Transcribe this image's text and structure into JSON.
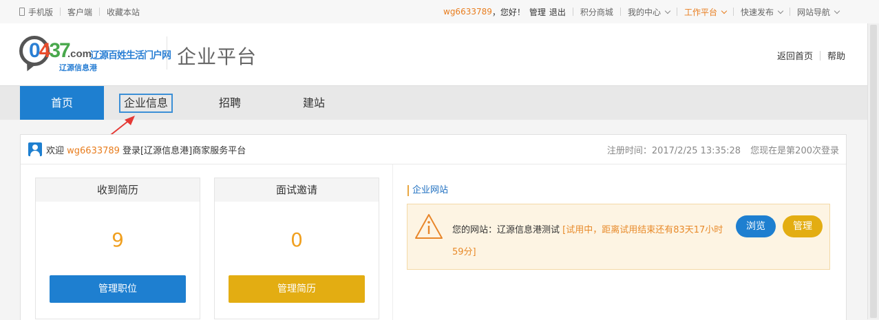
{
  "topbar": {
    "left": {
      "mobile": "手机版",
      "client": "客户端",
      "favorite": "收藏本站"
    },
    "right": {
      "username": "wg6633789",
      "greeting": "，您好！",
      "manage": "管理",
      "logout": "退出",
      "points_mall": "积分商城",
      "my_center": "我的中心",
      "work_platform": "工作平台",
      "quick_publish": "快速发布",
      "site_nav": "网站导航"
    }
  },
  "header": {
    "logo": {
      "digits": [
        "0",
        "4",
        "37"
      ],
      "domain": ".com",
      "slogan": "辽源百姓生活门户网",
      "subtitle": "辽源信息港"
    },
    "title": "企业平台",
    "links": {
      "home": "返回首页",
      "help": "帮助"
    }
  },
  "nav": {
    "tabs": [
      {
        "label": "首页"
      },
      {
        "label": "企业信息"
      },
      {
        "label": "招聘"
      },
      {
        "label": "建站"
      }
    ]
  },
  "welcome": {
    "prefix": "欢迎 ",
    "username": "wg6633789",
    "suffix": " 登录[辽源信息港]商家服务平台",
    "register_time": "注册时间：2017/2/25 13:35:28",
    "login_count": "您现在是第200次登录"
  },
  "stats": [
    {
      "title": "收到简历",
      "value": "9",
      "button": "管理职位"
    },
    {
      "title": "面试邀请",
      "value": "0",
      "button": "管理简历"
    }
  ],
  "site": {
    "section_title": "企业网站",
    "text": "您的网站：辽源信息港测试 ",
    "status": "[试用中，距离试用结束还有83天17小时59分]",
    "browse": "浏览",
    "manage": "管理"
  },
  "colors": {
    "accent_blue": "#1e7fd0",
    "accent_orange": "#e87d1e",
    "gold": "#e3ad12",
    "stat_number": "#f0a020"
  }
}
